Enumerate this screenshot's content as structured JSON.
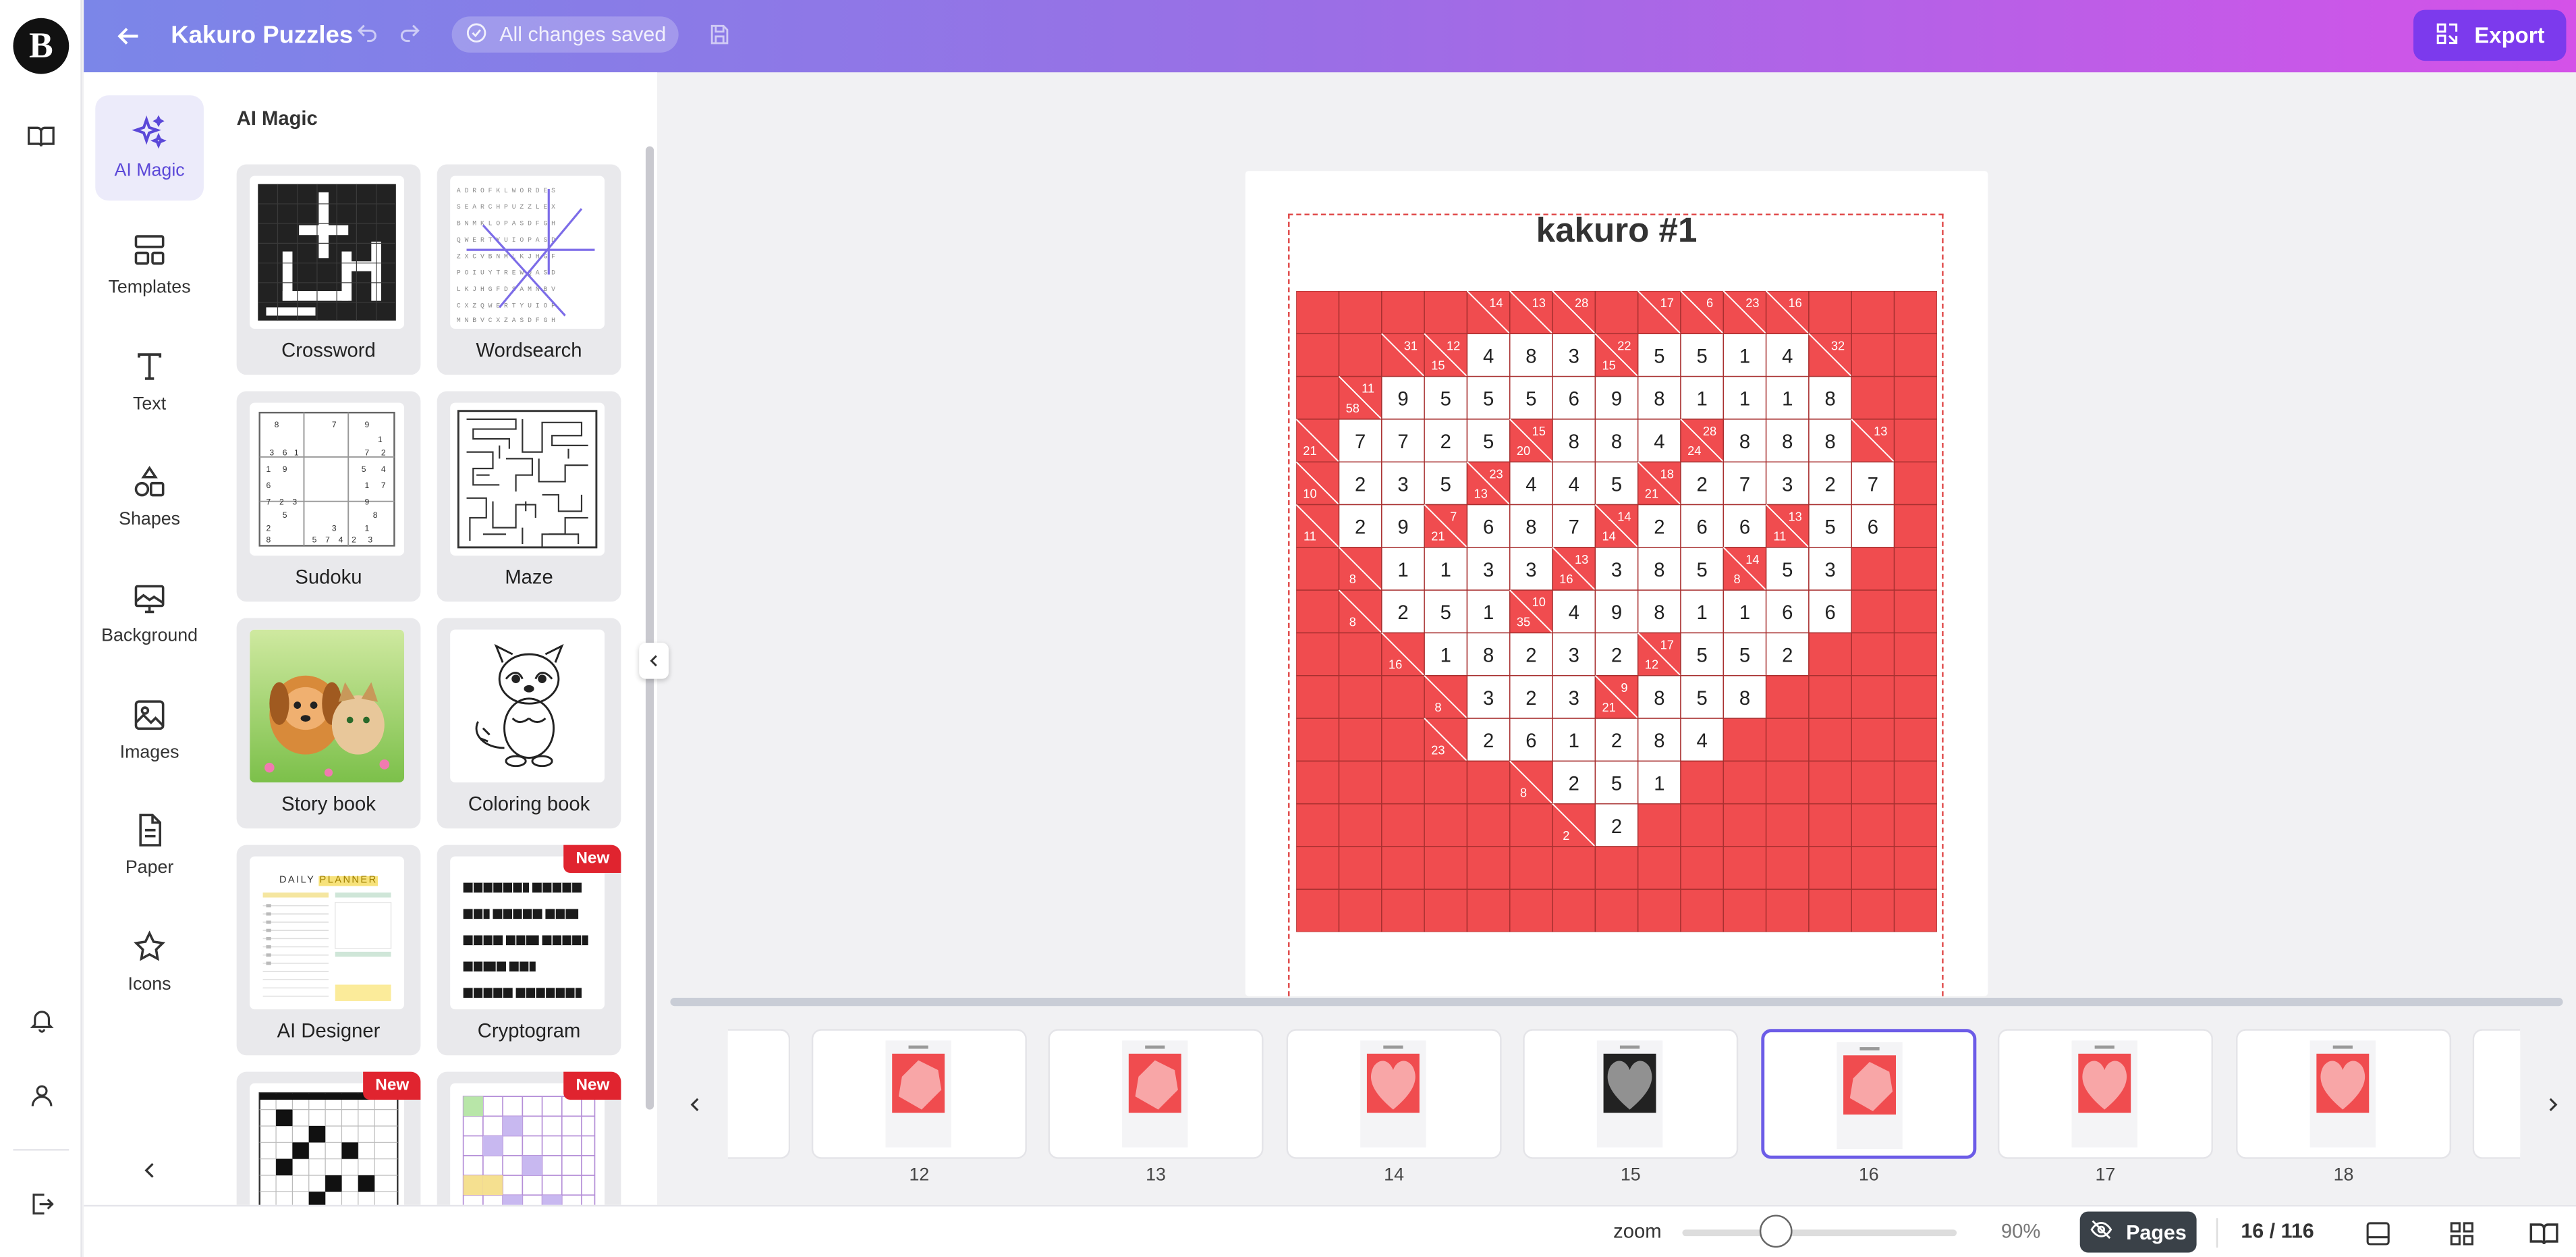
{
  "app": {
    "logo_letter": "B",
    "title": "Kakuro Puzzles",
    "saved_status": "All changes saved",
    "export_label": "Export",
    "brand_color": "#7c3aed",
    "puzzle_color": "#f04c4f"
  },
  "tools": [
    {
      "label": "AI Magic",
      "icon": "sparkles-icon",
      "active": true
    },
    {
      "label": "Templates",
      "icon": "templates-icon"
    },
    {
      "label": "Text",
      "icon": "text-icon"
    },
    {
      "label": "Shapes",
      "icon": "shapes-icon"
    },
    {
      "label": "Background",
      "icon": "background-icon"
    },
    {
      "label": "Images",
      "icon": "images-icon"
    },
    {
      "label": "Paper",
      "icon": "paper-icon"
    },
    {
      "label": "Icons",
      "icon": "star-icon"
    }
  ],
  "panel": {
    "title": "AI Magic",
    "cards": [
      {
        "label": "Crossword"
      },
      {
        "label": "Wordsearch"
      },
      {
        "label": "Sudoku"
      },
      {
        "label": "Maze"
      },
      {
        "label": "Story book"
      },
      {
        "label": "Coloring book"
      },
      {
        "label": "AI Designer"
      },
      {
        "label": "Cryptogram",
        "badge": "New"
      },
      {
        "label": "",
        "badge": "New"
      },
      {
        "label": "",
        "badge": "New"
      }
    ],
    "planner_text": {
      "line1": "DAILY",
      "line2": "PLANNER"
    }
  },
  "puzzle": {
    "title": "kakuro #1",
    "rows": [
      [
        "B",
        "B",
        "B",
        "B",
        "C:14",
        "C:13",
        "C:28",
        "B",
        "C:17",
        "C:6",
        "C:23",
        "C:16",
        "B",
        "B",
        "B"
      ],
      [
        "B",
        "B",
        "C:31",
        "C:12/15",
        "4",
        "8",
        "3",
        "C:22/15",
        "5",
        "5",
        "1",
        "4",
        "C:32",
        "B",
        "B"
      ],
      [
        "B",
        "C:11/58",
        "9",
        "5",
        "5",
        "5",
        "6",
        "9",
        "8",
        "1",
        "1",
        "1",
        "8",
        "B",
        "B"
      ],
      [
        "C:/21",
        "7",
        "7",
        "2",
        "5",
        "C:15/20",
        "8",
        "8",
        "4",
        "C:28/24",
        "8",
        "8",
        "8",
        "C:13",
        "B"
      ],
      [
        "C:/10",
        "2",
        "3",
        "5",
        "C:23/13",
        "4",
        "4",
        "5",
        "C:18/21",
        "2",
        "7",
        "3",
        "2",
        "7",
        "B"
      ],
      [
        "C:/11",
        "2",
        "9",
        "C:7/21",
        "6",
        "8",
        "7",
        "C:14/14",
        "2",
        "6",
        "6",
        "C:13/11",
        "5",
        "6",
        "B"
      ],
      [
        "B",
        "C:/8",
        "1",
        "1",
        "3",
        "3",
        "C:13/16",
        "3",
        "8",
        "5",
        "C:14/8",
        "5",
        "3",
        "B",
        "B"
      ],
      [
        "B",
        "C:/8",
        "2",
        "5",
        "1",
        "C:10/35",
        "4",
        "9",
        "8",
        "1",
        "1",
        "6",
        "6",
        "B",
        "B"
      ],
      [
        "B",
        "B",
        "C:/16",
        "1",
        "8",
        "2",
        "3",
        "2",
        "C:17/12",
        "5",
        "5",
        "2",
        "B",
        "B",
        "B"
      ],
      [
        "B",
        "B",
        "B",
        "C:/8",
        "3",
        "2",
        "3",
        "C:9/21",
        "8",
        "5",
        "8",
        "B",
        "B",
        "B",
        "B"
      ],
      [
        "B",
        "B",
        "B",
        "C:/23",
        "2",
        "6",
        "1",
        "2",
        "8",
        "4",
        "B",
        "B",
        "B",
        "B",
        "B"
      ],
      [
        "B",
        "B",
        "B",
        "B",
        "B",
        "C:/8",
        "2",
        "5",
        "1",
        "B",
        "B",
        "B",
        "B",
        "B",
        "B"
      ],
      [
        "B",
        "B",
        "B",
        "B",
        "B",
        "B",
        "C:/2",
        "2",
        "B",
        "B",
        "B",
        "B",
        "B",
        "B",
        "B"
      ],
      [
        "B",
        "B",
        "B",
        "B",
        "B",
        "B",
        "B",
        "B",
        "B",
        "B",
        "B",
        "B",
        "B",
        "B",
        "B"
      ],
      [
        "B",
        "B",
        "B",
        "B",
        "B",
        "B",
        "B",
        "B",
        "B",
        "B",
        "B",
        "B",
        "B",
        "B",
        "B"
      ]
    ]
  },
  "pages": {
    "thumbnails": [
      {
        "number": "12",
        "style": "red-tilt"
      },
      {
        "number": "13",
        "style": "red-tilt"
      },
      {
        "number": "14",
        "style": "red-heart"
      },
      {
        "number": "15",
        "style": "black"
      },
      {
        "number": "16",
        "style": "red-tilt",
        "active": true
      },
      {
        "number": "17",
        "style": "red-heart"
      },
      {
        "number": "18",
        "style": "red-heart"
      }
    ],
    "count": "16 / 116"
  },
  "bottom": {
    "zoom_label": "zoom",
    "zoom_percent": "90%",
    "zoom_value": 0.34,
    "pages_label": "Pages"
  }
}
